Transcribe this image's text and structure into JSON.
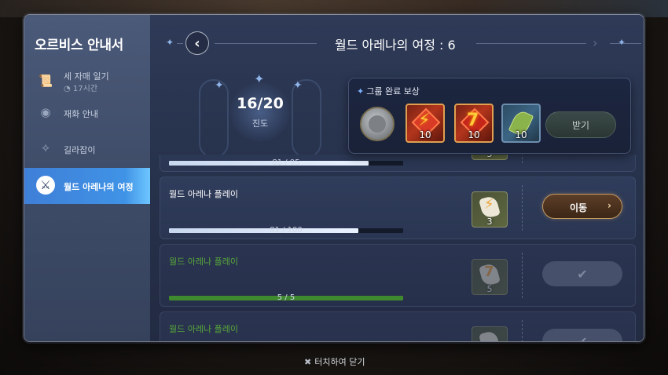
{
  "sidebar": {
    "title": "오르비스 안내서",
    "items": [
      {
        "label": "세 자매 일기",
        "sub": "17시간",
        "icon": "scroll-icon",
        "active": false
      },
      {
        "label": "재화 안내",
        "icon": "coin-icon",
        "active": false
      },
      {
        "label": "길라잡이",
        "icon": "compass-icon",
        "active": false
      },
      {
        "label": "월드 아레나의 여정",
        "icon": "sword-icon",
        "active": true
      }
    ]
  },
  "header": {
    "title": "월드 아레나의 여정 : 6",
    "back_icon": "chevron-left-icon",
    "next_icon": "chevron-right-icon"
  },
  "progress": {
    "count": "16/20",
    "label": "진도"
  },
  "reward_panel": {
    "title": "그룹 완료 보상",
    "items": [
      {
        "icon": "silver-coin-icon",
        "qty": ""
      },
      {
        "icon": "red-gem-icon",
        "qty": "10"
      },
      {
        "icon": "red-gem-icon",
        "qty": "10"
      },
      {
        "icon": "herb-icon",
        "qty": "10"
      }
    ],
    "receive_label": "받기"
  },
  "missions": [
    {
      "title": "",
      "progress_text": "81 / 95",
      "progress": 0.853,
      "reward_qty": "5",
      "state": "move"
    },
    {
      "title": "월드 아레나 플레이",
      "progress_text": "81 / 100",
      "progress": 0.81,
      "reward_qty": "3",
      "state": "move",
      "button_label": "이동"
    },
    {
      "title": "월드 아레나 플레이",
      "progress_text": "5 / 5",
      "progress": 1.0,
      "reward_qty": "5",
      "state": "done"
    },
    {
      "title": "월드 아레나 플레이",
      "progress_text": "",
      "progress": 1.0,
      "reward_qty": "",
      "state": "done"
    }
  ],
  "close_hint": "터치하여 닫기",
  "colors": {
    "accent_blue": "#3f8fe4",
    "completed_green": "#58a83a",
    "move_button_border": "#c59a62"
  }
}
